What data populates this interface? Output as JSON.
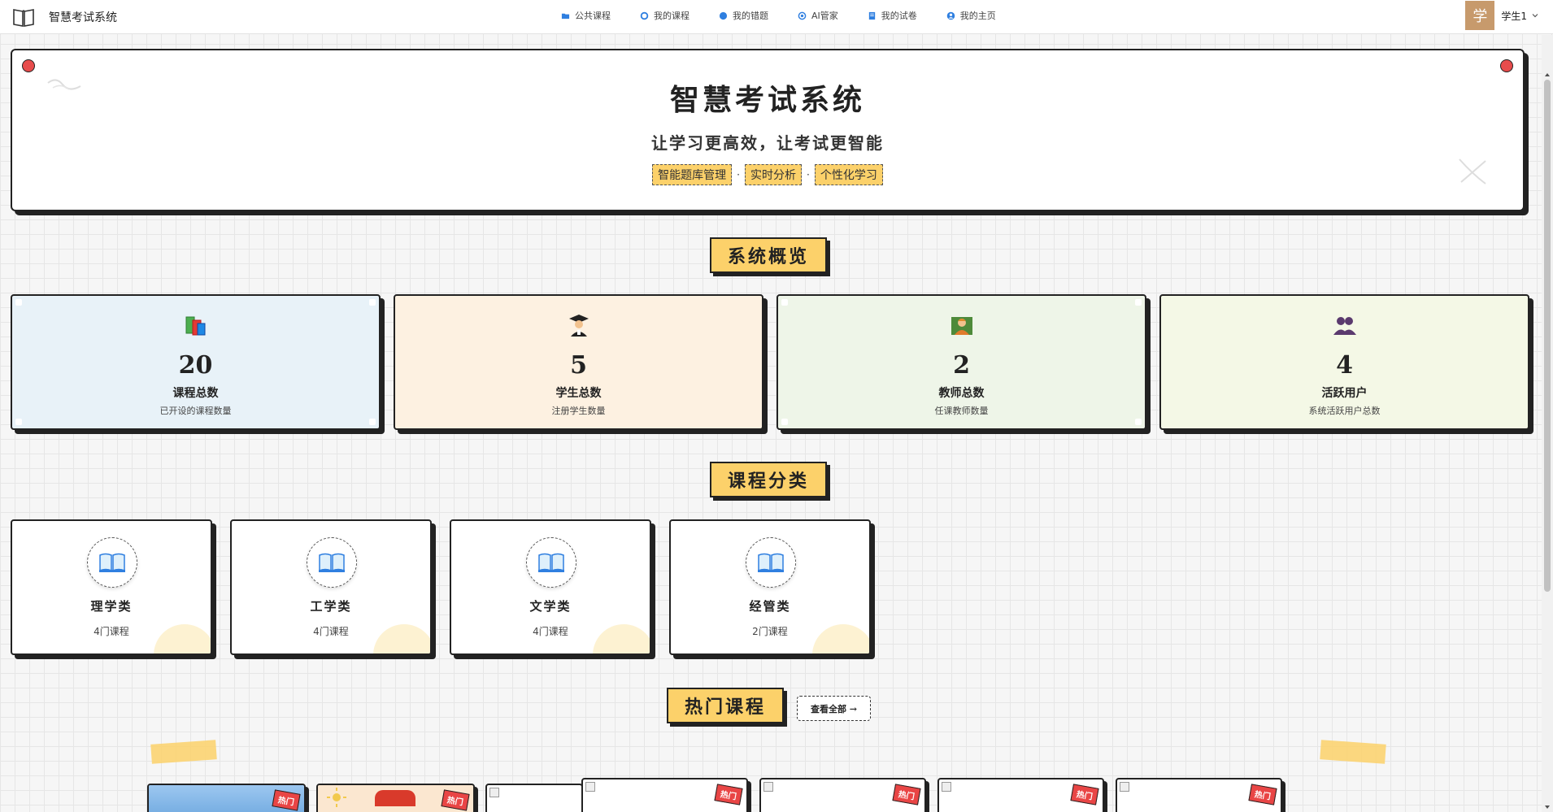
{
  "app": {
    "title": "智慧考试系统"
  },
  "nav": {
    "items": [
      {
        "label": "公共课程",
        "icon": "folder-icon",
        "color": "#2f7fe0"
      },
      {
        "label": "我的课程",
        "icon": "circle-icon",
        "color": "#2f7fe0"
      },
      {
        "label": "我的错题",
        "icon": "circle-filled-icon",
        "color": "#2f7fe0"
      },
      {
        "label": "AI管家",
        "icon": "target-icon",
        "color": "#2f7fe0"
      },
      {
        "label": "我的试卷",
        "icon": "document-icon",
        "color": "#2f7fe0"
      },
      {
        "label": "我的主页",
        "icon": "user-icon",
        "color": "#2f7fe0"
      }
    ]
  },
  "user": {
    "avatar_text": "学",
    "name": "学生1"
  },
  "hero": {
    "title": "智慧考试系统",
    "subtitle": "让学习更高效，让考试更智能",
    "tags": [
      "智能题库管理",
      "实时分析",
      "个性化学习"
    ],
    "separator": "·"
  },
  "overview": {
    "title": "系统概览",
    "stats": [
      {
        "value": "20",
        "label": "课程总数",
        "desc": "已开设的课程数量",
        "icon": "books-icon",
        "bg": "#e8f2f8"
      },
      {
        "value": "5",
        "label": "学生总数",
        "desc": "注册学生数量",
        "icon": "graduate-icon",
        "bg": "#fdf1e1"
      },
      {
        "value": "2",
        "label": "教师总数",
        "desc": "任课教师数量",
        "icon": "teacher-icon",
        "bg": "#eef5e8"
      },
      {
        "value": "4",
        "label": "活跃用户",
        "desc": "系统活跃用户总数",
        "icon": "users-icon",
        "bg": "#f4f8e6"
      }
    ]
  },
  "categories": {
    "title": "课程分类",
    "items": [
      {
        "name": "理学类",
        "count": "4门课程",
        "icon": "open-book-icon"
      },
      {
        "name": "工学类",
        "count": "4门课程",
        "icon": "open-book-icon"
      },
      {
        "name": "文学类",
        "count": "4门课程",
        "icon": "open-book-icon"
      },
      {
        "name": "经管类",
        "count": "2门课程",
        "icon": "open-book-icon"
      }
    ]
  },
  "hot_courses": {
    "title": "热门课程",
    "view_all": "查看全部 →",
    "badge": "热门"
  },
  "colors": {
    "accent_yellow": "#fcd16a",
    "pin_red": "#e74c4c",
    "hot_red": "#e94545",
    "ink": "#222222"
  }
}
